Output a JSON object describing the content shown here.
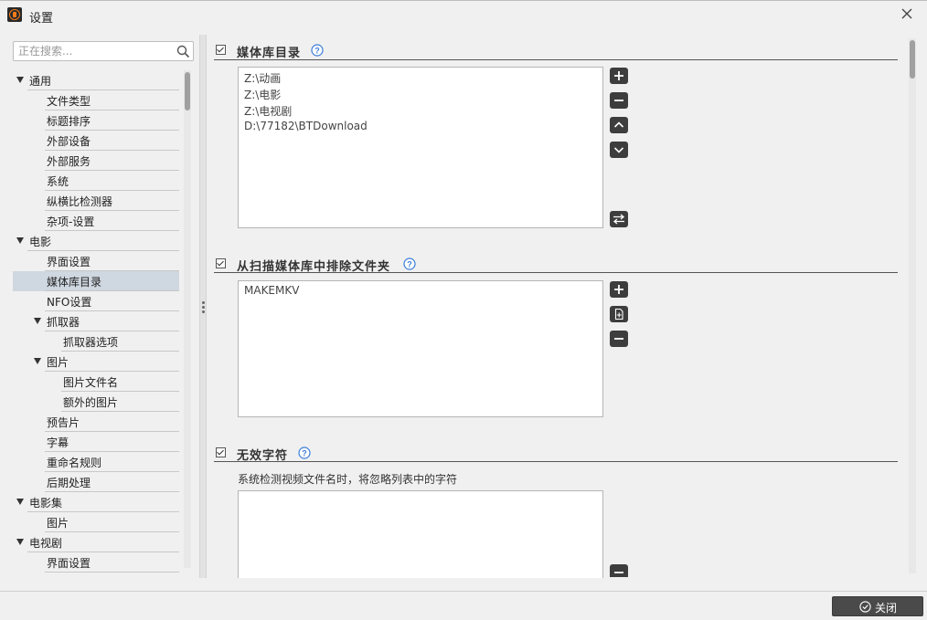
{
  "window": {
    "title": "设置"
  },
  "search": {
    "placeholder": "正在搜索..."
  },
  "tree": [
    {
      "label": "通用",
      "level": 0,
      "expanded": true
    },
    {
      "label": "文件类型",
      "level": 1
    },
    {
      "label": "标题排序",
      "level": 1
    },
    {
      "label": "外部设备",
      "level": 1
    },
    {
      "label": "外部服务",
      "level": 1
    },
    {
      "label": "系统",
      "level": 1
    },
    {
      "label": "纵横比检测器",
      "level": 1
    },
    {
      "label": "杂项-设置",
      "level": 1
    },
    {
      "label": "电影",
      "level": 0,
      "expanded": true
    },
    {
      "label": "界面设置",
      "level": 1
    },
    {
      "label": "媒体库目录",
      "level": 1,
      "selected": true
    },
    {
      "label": "NFO设置",
      "level": 1
    },
    {
      "label": "抓取器",
      "level": 1,
      "expanded": true
    },
    {
      "label": "抓取器选项",
      "level": 2
    },
    {
      "label": "图片",
      "level": 1,
      "expanded": true
    },
    {
      "label": "图片文件名",
      "level": 2
    },
    {
      "label": "额外的图片",
      "level": 2
    },
    {
      "label": "预告片",
      "level": 1
    },
    {
      "label": "字幕",
      "level": 1
    },
    {
      "label": "重命名规则",
      "level": 1
    },
    {
      "label": "后期处理",
      "level": 1
    },
    {
      "label": "电影集",
      "level": 0,
      "expanded": true
    },
    {
      "label": "图片",
      "level": 1
    },
    {
      "label": "电视剧",
      "level": 0,
      "expanded": true
    },
    {
      "label": "界面设置",
      "level": 1
    }
  ],
  "sections": {
    "media_dirs": {
      "title": "媒体库目录",
      "items": [
        "Z:\\动画",
        "Z:\\电影",
        "Z:\\电视剧",
        "D:\\77182\\BTDownload"
      ]
    },
    "exclude_dirs": {
      "title": "从扫描媒体库中排除文件夹",
      "items": [
        "MAKEMKV"
      ]
    },
    "bad_words": {
      "title": "无效字符",
      "description": "系统检测视频文件名时，将忽略列表中的字符",
      "items": []
    }
  },
  "footer": {
    "close_label": "关闭"
  }
}
